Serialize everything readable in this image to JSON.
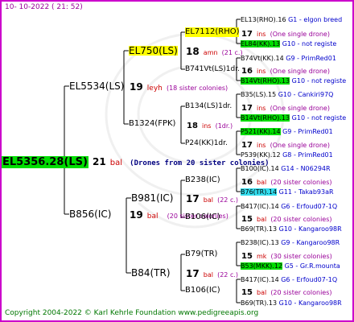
{
  "header": {
    "date": "10- 10-2022 ( 21: 52)"
  },
  "root": {
    "name": "EL5356.28(LS)",
    "num": "21",
    "mark": "bal",
    "note": "(Drones from 20 sister colonies)"
  },
  "gen1": {
    "top": {
      "name": "EL5534(LS)",
      "num": "19",
      "mark": "leyh",
      "note": "(18 sister colonies)"
    },
    "bottom": {
      "name": "B856(IC)",
      "num": "19",
      "mark": "bal",
      "note": "(20 sister colonies)"
    }
  },
  "gen2": [
    {
      "name": "EL750(LS)",
      "num": "18",
      "mark": "amn",
      "note": "(21 c.)"
    },
    {
      "name": "B1324(FPK)",
      "num": "18",
      "mark": "ins",
      "note": "(1dr.)"
    },
    {
      "name": "B981(IC)",
      "num": "17",
      "mark": "bal",
      "note": "(22 c.)"
    },
    {
      "name": "B84(TR)",
      "num": "17",
      "mark": "bal",
      "note": "(22 c.)"
    }
  ],
  "gen3": [
    {
      "name": "EL7112(RHO)",
      "num": "17",
      "mark": "ins",
      "note": "(One single drone)"
    },
    {
      "name": "B741Vt(LS)1dr.",
      "num": "16",
      "mark": "ins",
      "note": "(One single drone)"
    },
    {
      "name": "B134(LS)1dr.",
      "num": "17",
      "mark": "ins",
      "note": "(One single drone)"
    },
    {
      "name": "P24(KK)1dr.",
      "num": "17",
      "mark": "ins",
      "note": "(One single drone)"
    },
    {
      "name": "B238(IC)",
      "num": "16",
      "mark": "bal",
      "note": "(20 sister colonies)"
    },
    {
      "name": "B106(IC)",
      "num": "15",
      "mark": "bal",
      "note": "(20 sister colonies)"
    },
    {
      "name": "B79(TR)",
      "num": "15",
      "mark": "mk",
      "note": "(30 sister colonies)"
    },
    {
      "name": "B106(IC)",
      "num": "15",
      "mark": "bal",
      "note": "(20 sister colonies)"
    }
  ],
  "gen4": [
    {
      "name": "EL13(RHO).16",
      "info": "G1 - elgon breed"
    },
    {
      "name": "EL84(KK).13",
      "info": "G10 - not registe"
    },
    {
      "name": "B74Vt(KK).14",
      "info": "G9 - PrimRed01"
    },
    {
      "name": "B14Vt(RHO).13",
      "info": "G10 - not registe"
    },
    {
      "name": "B35(LS).15",
      "info": "G10 - Cankiri97Q"
    },
    {
      "name": "B14Vt(RHO).13",
      "info": "G10 - not registe"
    },
    {
      "name": "P521(KK).14",
      "info": "G9 - PrimRed01"
    },
    {
      "name": "P539(KK).12",
      "info": "G8 - PrimRed01"
    },
    {
      "name": "B100(IC).14",
      "info": "G14 - N06294R"
    },
    {
      "name": "B76(TR).14",
      "info": "G11 - Takab93aR"
    },
    {
      "name": "B417(IC).14",
      "info": "G6 - Erfoud07-1Q"
    },
    {
      "name": "B69(TR).13",
      "info": "G10 - Kangaroo98R"
    },
    {
      "name": "B238(IC).13",
      "info": "G9 - Kangaroo98R"
    },
    {
      "name": "B53(MKK).12",
      "info": "G5 - Gr.R.mounta"
    },
    {
      "name": "B417(IC).14",
      "info": "G6 - Erfoud07-1Q"
    },
    {
      "name": "B69(TR).13",
      "info": "G10 - Kangaroo98R"
    }
  ],
  "footer": {
    "text": "Copyright 2004-2022 © Karl Kehrle Foundation    www.pedigreeapis.org"
  },
  "colors": {
    "frame": "#cc00cc",
    "highlight_green": "#00dd00",
    "highlight_yellow": "#ffff00",
    "highlight_cyan": "#33ddee",
    "lines": "#000000"
  }
}
